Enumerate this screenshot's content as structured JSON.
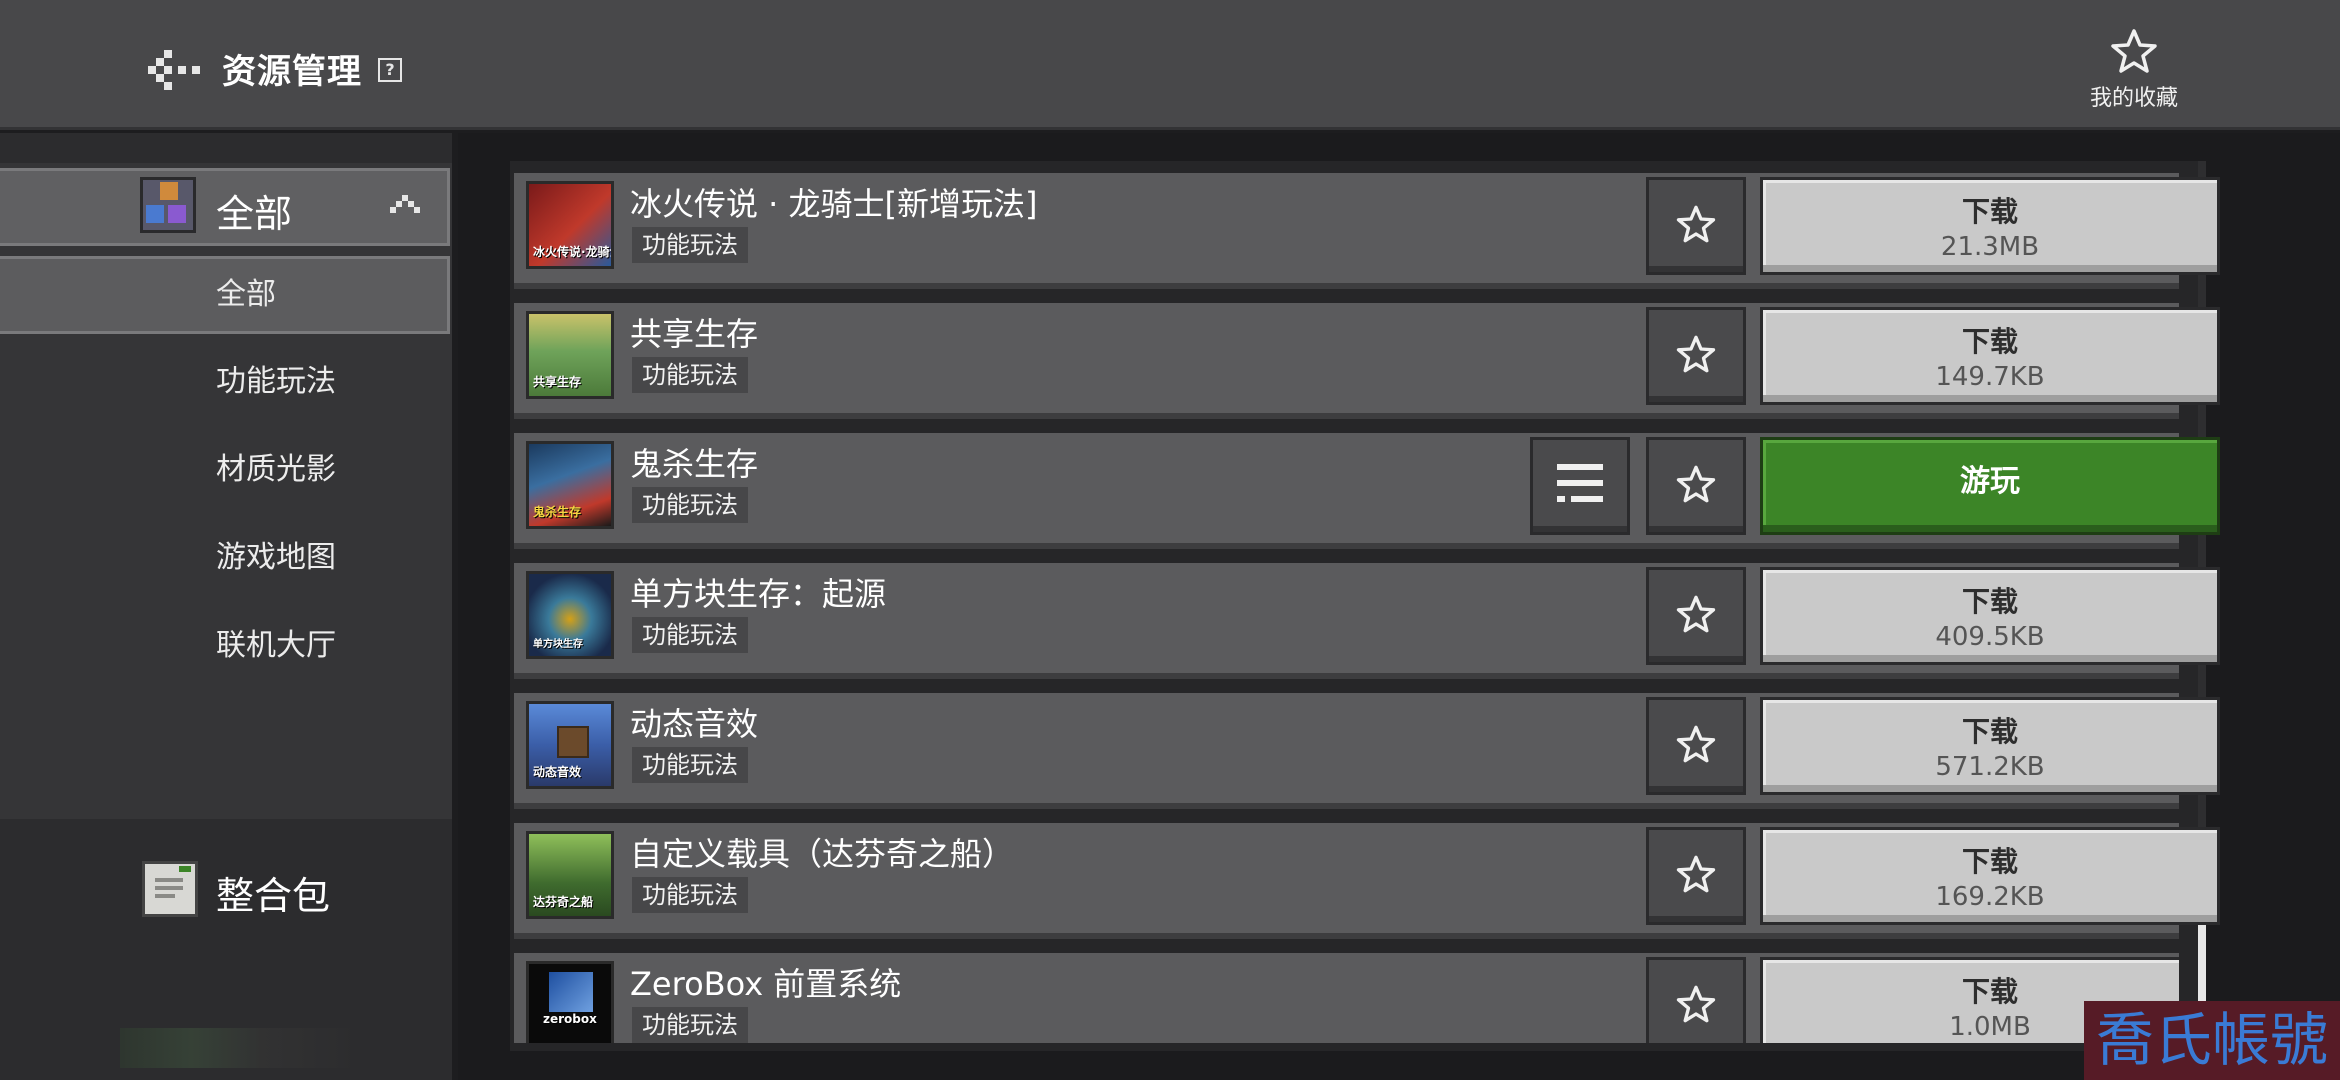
{
  "header": {
    "title": "资源管理",
    "help_glyph": "?",
    "favorites_label": "我的收藏"
  },
  "sidebar": {
    "category_all": "全部",
    "sub_items": [
      {
        "label": "全部",
        "selected": true
      },
      {
        "label": "功能玩法",
        "selected": false
      },
      {
        "label": "材质光影",
        "selected": false
      },
      {
        "label": "游戏地图",
        "selected": false
      },
      {
        "label": "联机大厅",
        "selected": false
      }
    ],
    "pack_label": "整合包"
  },
  "list": {
    "items": [
      {
        "title": "冰火传说 · 龙骑士[新增玩法]",
        "tag": "功能玩法",
        "action": "下载",
        "size": "21.3MB",
        "thumb_text": "冰火传说·龙骑士",
        "thumb_colors": [
          "#7a1a1a",
          "#c0392b"
        ]
      },
      {
        "title": "共享生存",
        "tag": "功能玩法",
        "action": "下载",
        "size": "149.7KB",
        "thumb_text": "共享生存",
        "thumb_colors": [
          "#c9c26a",
          "#4c7a3a"
        ]
      },
      {
        "title": "鬼杀生存",
        "tag": "功能玩法",
        "action": "游玩",
        "size": "",
        "thumb_text": "鬼杀生存",
        "thumb_colors": [
          "#1b3a5e",
          "#c0392b"
        ]
      },
      {
        "title": "单方块生存：起源",
        "tag": "功能玩法",
        "action": "下载",
        "size": "409.5KB",
        "thumb_text": "单方块生存",
        "thumb_colors": [
          "#1a2a4a",
          "#d4a017"
        ]
      },
      {
        "title": "动态音效",
        "tag": "功能玩法",
        "action": "下载",
        "size": "571.2KB",
        "thumb_text": "动态音效",
        "thumb_colors": [
          "#3b5ea8",
          "#6b4a2b"
        ]
      },
      {
        "title": "自定义载具（达芬奇之船）",
        "tag": "功能玩法",
        "action": "下载",
        "size": "169.2KB",
        "thumb_text": "达芬奇之船",
        "thumb_colors": [
          "#3f6b2e",
          "#8fbf5a"
        ]
      },
      {
        "title": "ZeroBox 前置系统",
        "tag": "功能玩法",
        "action": "下载",
        "size": "1.0MB",
        "thumb_text": "zerobox",
        "thumb_colors": [
          "#0a0a0a",
          "#1e4fa0"
        ]
      }
    ]
  },
  "watermark": "喬氏帳號",
  "colors": {
    "topbar": "#48484a",
    "play_green": "#3c8527",
    "download_gray": "#c9c9c9"
  }
}
